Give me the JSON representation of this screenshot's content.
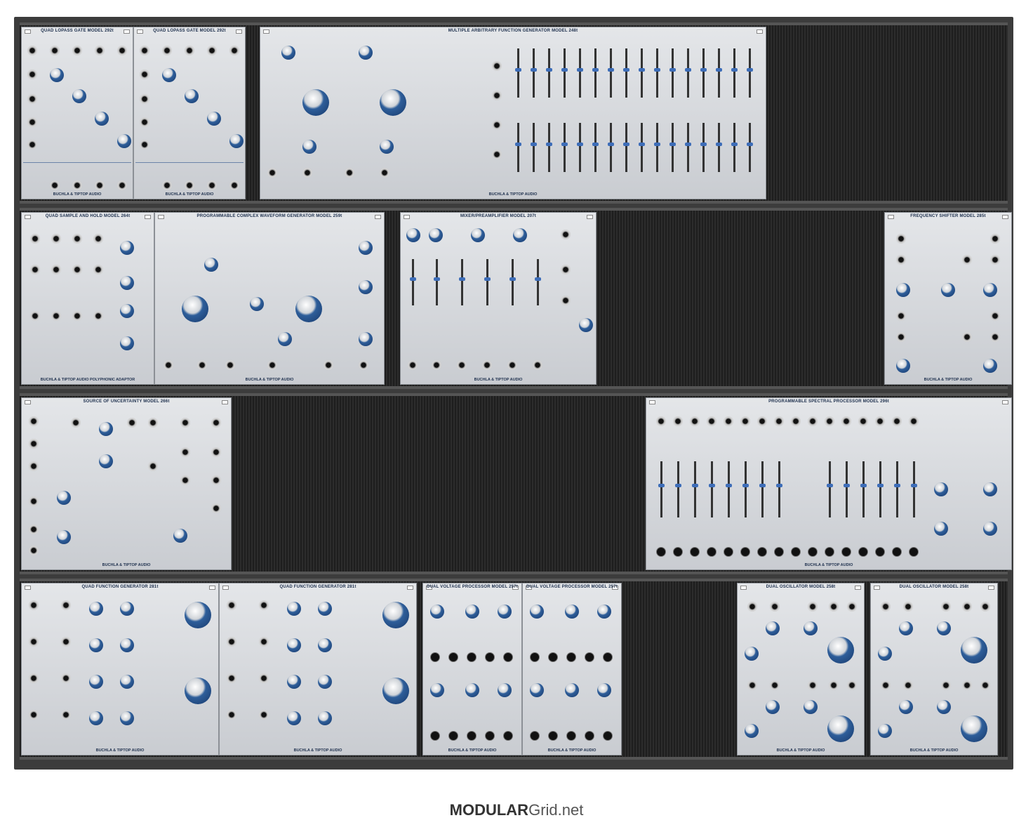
{
  "rows": [
    {
      "modules": [
        {
          "title": "QUAD LOPASS GATE MODEL 292t",
          "brand": "BUCHLA & TIPTOP AUDIO"
        },
        {
          "title": "QUAD LOPASS GATE MODEL 292t",
          "brand": "BUCHLA & TIPTOP AUDIO"
        },
        {
          "title": "MULTIPLE ARBITRARY FUNCTION GENERATOR MODEL 248t",
          "brand": "BUCHLA & TIPTOP AUDIO"
        }
      ]
    },
    {
      "modules": [
        {
          "title": "QUAD SAMPLE AND HOLD MODEL 264t",
          "brand": "BUCHLA & TIPTOP AUDIO POLYPHONIC ADAPTOR"
        },
        {
          "title": "PROGRAMMABLE COMPLEX WAVEFORM GENERATOR MODEL 259t",
          "brand": "BUCHLA & TIPTOP AUDIO"
        },
        {
          "title": "MIXER/PREAMPLIFIER MODEL 207t",
          "brand": "BUCHLA & TIPTOP AUDIO"
        },
        {
          "title": "FREQUENCY SHIFTER MODEL 285t",
          "brand": "BUCHLA & TIPTOP AUDIO"
        }
      ]
    },
    {
      "modules": [
        {
          "title": "SOURCE OF UNCERTAINTY MODEL 266t",
          "brand": "BUCHLA & TIPTOP AUDIO"
        },
        {
          "title": "PROGRAMMABLE SPECTRAL PROCESSOR MODEL 296t",
          "brand": "BUCHLA & TIPTOP AUDIO"
        }
      ]
    },
    {
      "modules": [
        {
          "title": "QUAD FUNCTION GENERATOR 281t",
          "brand": "BUCHLA & TIPTOP AUDIO"
        },
        {
          "title": "QUAD FUNCTION GENERATOR 281t",
          "brand": "BUCHLA & TIPTOP AUDIO"
        },
        {
          "title": "DUAL VOLTAGE PROCESSOR MODEL 257t",
          "brand": "BUCHLA & TIPTOP AUDIO"
        },
        {
          "title": "DUAL VOLTAGE PROCESSOR MODEL 257t",
          "brand": "BUCHLA & TIPTOP AUDIO"
        },
        {
          "title": "DUAL OSCILLATOR MODEL 258t",
          "brand": "BUCHLA & TIPTOP AUDIO"
        },
        {
          "title": "DUAL OSCILLATOR MODEL 258t",
          "brand": "BUCHLA & TIPTOP AUDIO"
        }
      ]
    }
  ],
  "watermark": {
    "bold": "MODULAR",
    "rest": "Grid.net"
  },
  "colors": {
    "panel": "#d8dbe0",
    "accent_blue": "#2e5e9a",
    "rack": "#3c3c3c"
  }
}
